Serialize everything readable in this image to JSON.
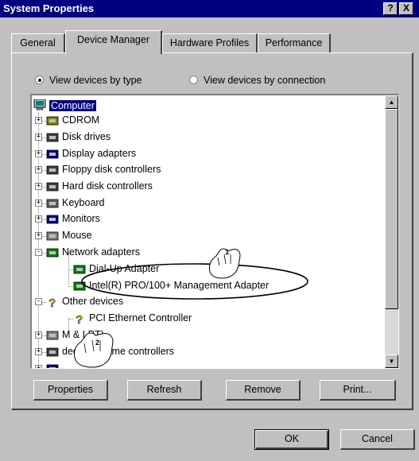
{
  "window": {
    "title": "System Properties",
    "help_label": "?",
    "close_label": "X"
  },
  "tabs": [
    {
      "label": "General"
    },
    {
      "label": "Device Manager"
    },
    {
      "label": "Hardware Profiles"
    },
    {
      "label": "Performance"
    }
  ],
  "view_options": {
    "by_type": "View devices by type",
    "by_connection": "View devices by connection",
    "selected": "by_type"
  },
  "tree": {
    "root": "Computer",
    "items": [
      {
        "label": "CDROM",
        "icon": "cdrom-icon",
        "expander": "+"
      },
      {
        "label": "Disk drives",
        "icon": "disk-drive-icon",
        "expander": "+"
      },
      {
        "label": "Display adapters",
        "icon": "display-adapter-icon",
        "expander": "+"
      },
      {
        "label": "Floppy disk controllers",
        "icon": "floppy-controller-icon",
        "expander": "+"
      },
      {
        "label": "Hard disk controllers",
        "icon": "hard-disk-controller-icon",
        "expander": "+"
      },
      {
        "label": "Keyboard",
        "icon": "keyboard-icon",
        "expander": "+"
      },
      {
        "label": "Monitors",
        "icon": "monitor-icon",
        "expander": "+"
      },
      {
        "label": "Mouse",
        "icon": "mouse-icon",
        "expander": "+"
      },
      {
        "label": "Network adapters",
        "icon": "network-adapter-icon",
        "expander": "-"
      },
      {
        "label": "Dial-Up Adapter",
        "icon": "network-card-icon",
        "child": true
      },
      {
        "label": "Intel(R) PRO/100+ Management Adapter",
        "icon": "network-card-icon",
        "child": true
      },
      {
        "label": "Other devices",
        "icon": "question-mark-icon",
        "expander": "-"
      },
      {
        "label": "PCI Ethernet Controller",
        "icon": "warning-question-icon",
        "child": true
      },
      {
        "label": "M & LPT)",
        "icon": "port-icon",
        "expander": "+"
      },
      {
        "label": "deo and game controllers",
        "icon": "sound-icon",
        "expander": "+"
      },
      {
        "label": "...",
        "icon": "system-icon",
        "expander": "+"
      }
    ]
  },
  "buttons": {
    "properties": "Properties",
    "refresh": "Refresh",
    "remove": "Remove",
    "print": "Print...",
    "ok": "OK",
    "cancel": "Cancel"
  },
  "callouts": {
    "hand1": "1",
    "hand2": "2"
  }
}
